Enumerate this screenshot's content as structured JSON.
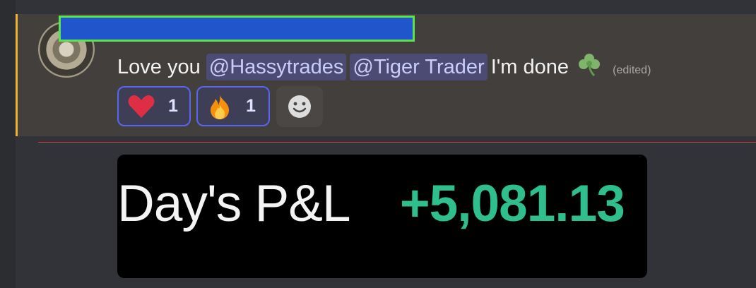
{
  "message": {
    "author_name": "",
    "text_prefix": "Love you",
    "mentions": [
      "@Hassytrades",
      "@Tiger Trader"
    ],
    "text_suffix": "I'm done",
    "emoji": "shamrock-icon",
    "edited_label": "(edited)"
  },
  "reactions": [
    {
      "emoji": "heart-icon",
      "count": "1",
      "selected": true
    },
    {
      "emoji": "fire-icon",
      "count": "1",
      "selected": true
    }
  ],
  "add_reaction": {
    "icon": "smiley-icon"
  },
  "embed": {
    "label": "Day's P&L",
    "value": "+5,081.13"
  },
  "colors": {
    "mention_bg": "#4c4b74",
    "reaction_border": "#5865f2",
    "pnl_green": "#2fbf8f",
    "highlight_bar": "#f0b232",
    "new_divider": "#c7444a"
  }
}
